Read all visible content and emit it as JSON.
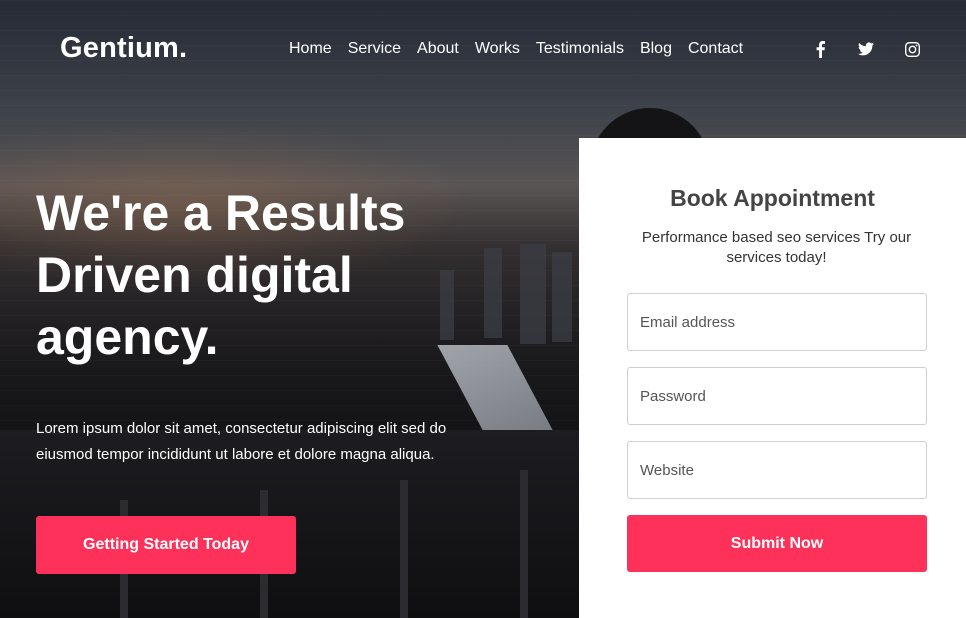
{
  "brand": {
    "logo": "Gentium."
  },
  "nav": {
    "items": [
      {
        "label": "Home"
      },
      {
        "label": "Service"
      },
      {
        "label": "About"
      },
      {
        "label": "Works"
      },
      {
        "label": "Testimonials"
      },
      {
        "label": "Blog"
      },
      {
        "label": "Contact"
      }
    ]
  },
  "social": {
    "icons": [
      "facebook-icon",
      "twitter-icon",
      "instagram-icon"
    ]
  },
  "hero": {
    "headline": "We're a Results Driven digital agency.",
    "description": "Lorem ipsum dolor sit amet, consectetur adipiscing elit sed do eiusmod tempor incididunt ut labore et dolore magna aliqua.",
    "cta_label": "Getting Started Today"
  },
  "form": {
    "title": "Book Appointment",
    "subtitle": "Performance based seo services Try our services today!",
    "email_placeholder": "Email address",
    "password_placeholder": "Password",
    "website_placeholder": "Website",
    "submit_label": "Submit Now"
  },
  "colors": {
    "accent": "#fd3159",
    "card_bg": "#ffffff",
    "text_light": "#ffffff"
  }
}
